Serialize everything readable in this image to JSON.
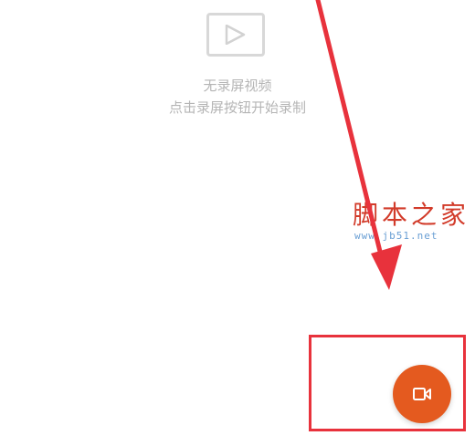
{
  "empty_state": {
    "icon": "video-play-icon",
    "title": "无录屏视频",
    "hint": "点击录屏按钮开始录制"
  },
  "watermark": {
    "name": "脚本之家",
    "url": "www.jb51.net"
  },
  "record_button": {
    "icon": "video-camera-icon"
  },
  "colors": {
    "accent": "#e45a1f",
    "annotation": "#e8323c",
    "placeholder_text": "#b5b5b5",
    "placeholder_icon": "#d8d8d8"
  }
}
